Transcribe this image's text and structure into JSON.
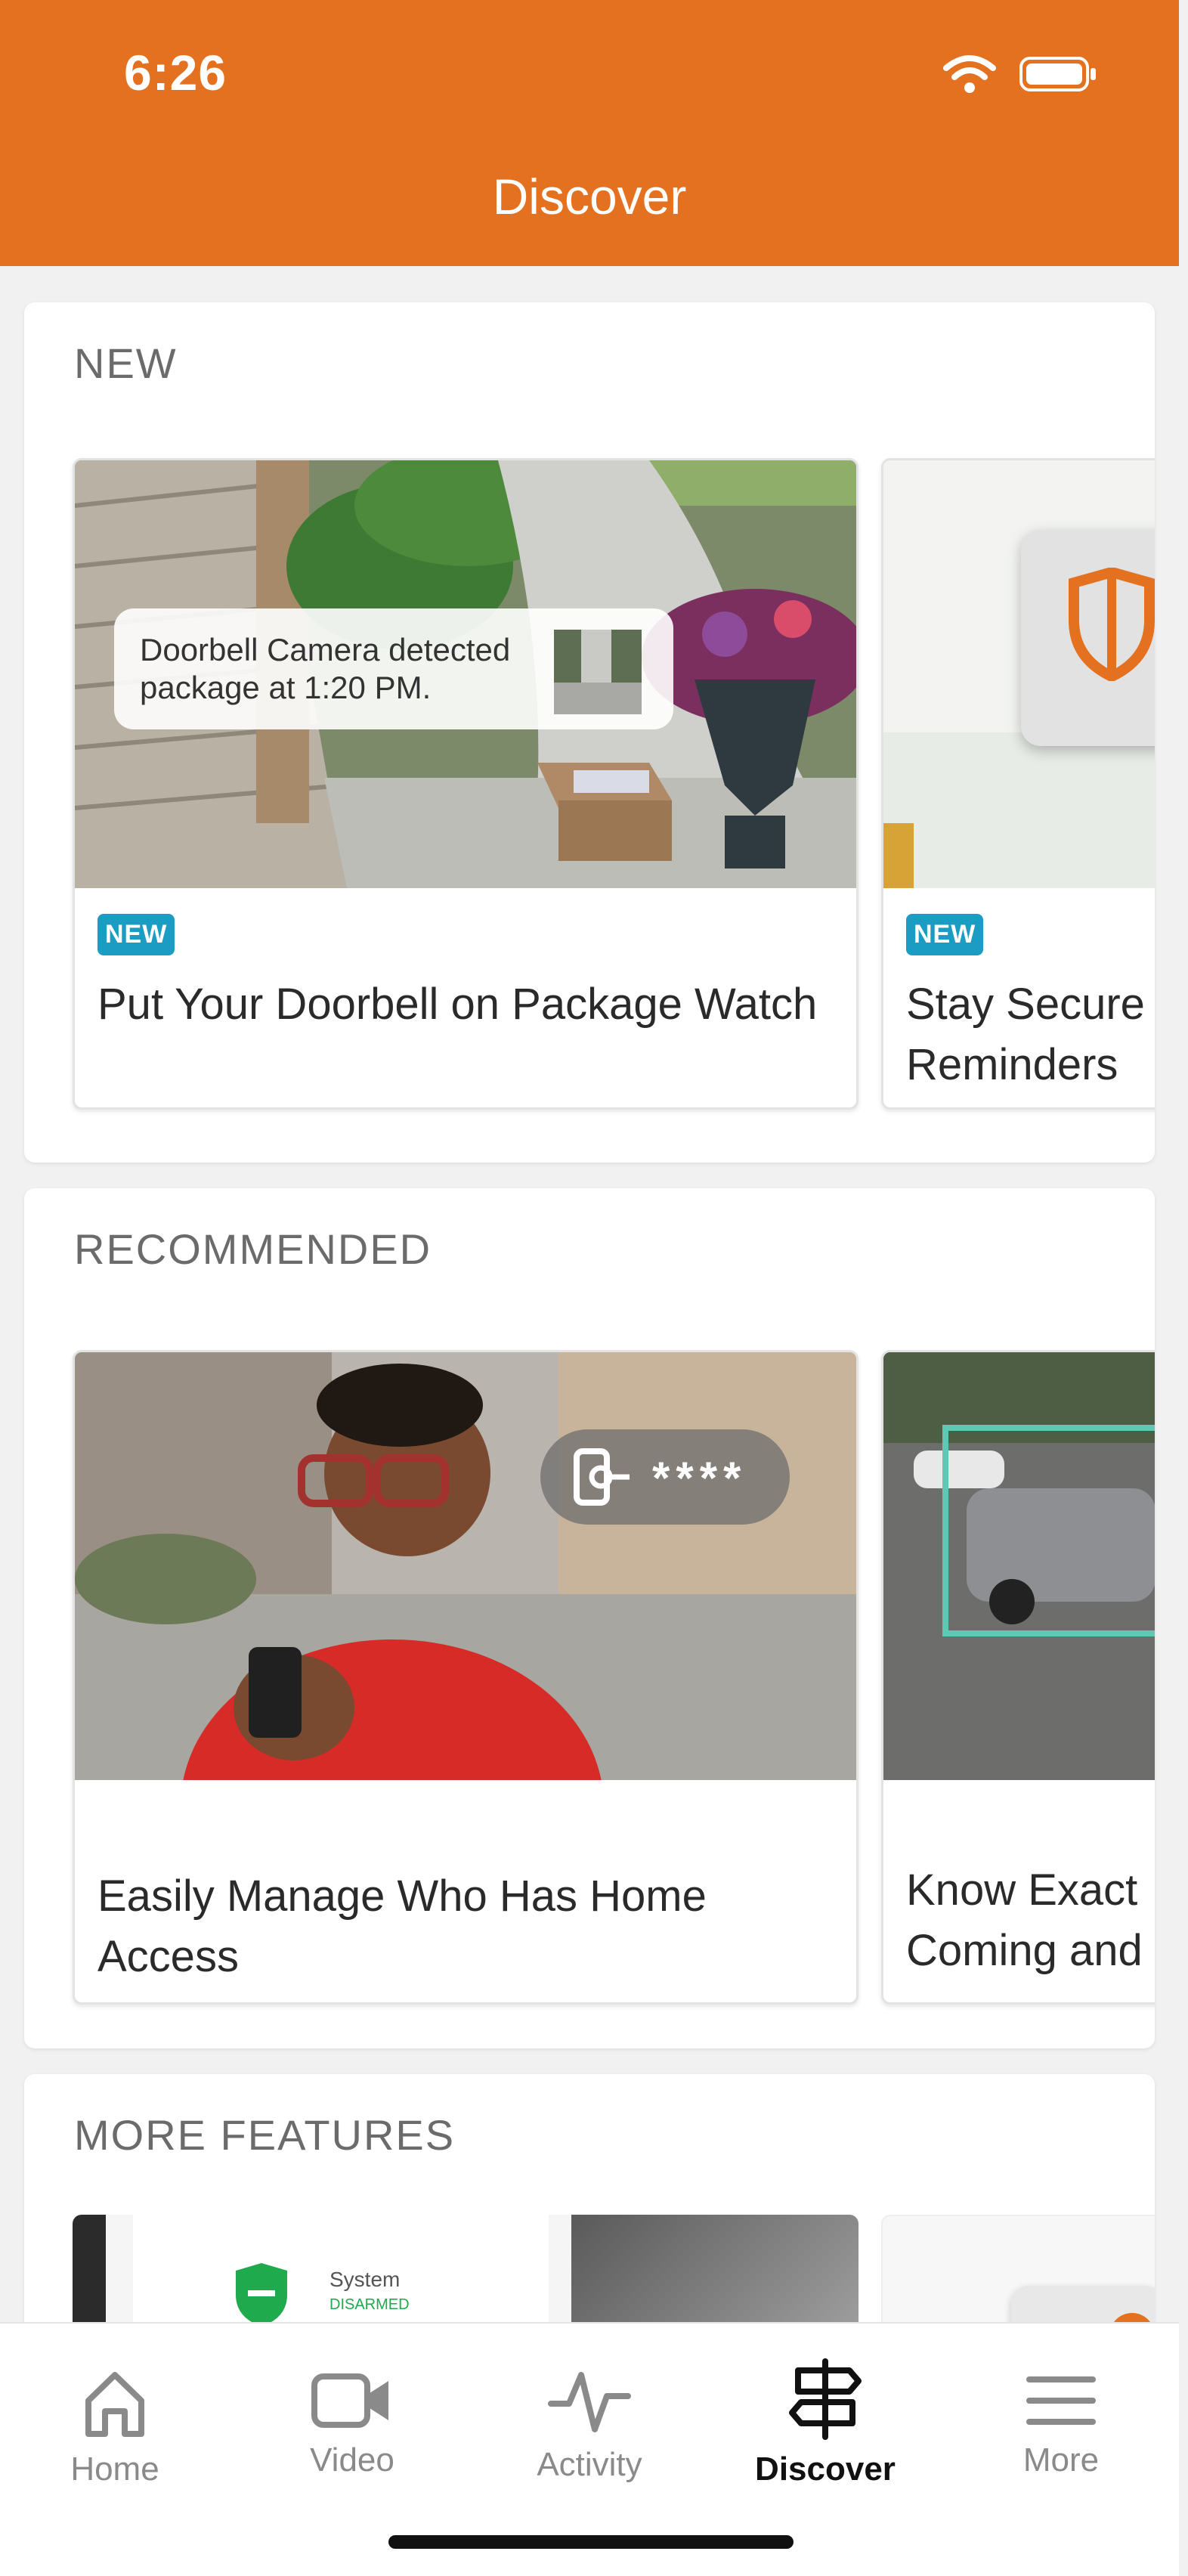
{
  "status": {
    "time": "6:26"
  },
  "header": {
    "title": "Discover"
  },
  "sections": {
    "new": {
      "title": "NEW",
      "cards": [
        {
          "badge": "NEW",
          "title": "Put Your Doorbell on Package Watch",
          "notification": "Doorbell Camera detected package at 1:20 PM."
        },
        {
          "badge": "NEW",
          "title": "Stay Secure Reminders"
        }
      ]
    },
    "recommended": {
      "title": "RECOMMENDED",
      "cards": [
        {
          "title": "Easily Manage Who Has Home Access",
          "pin_overlay": "****"
        },
        {
          "title": "Know Exact Coming and"
        }
      ]
    },
    "more": {
      "title": "MORE FEATURES",
      "preview_text": [
        "System",
        "DISARMED"
      ]
    }
  },
  "tabs": [
    {
      "label": "Home",
      "icon": "home-icon"
    },
    {
      "label": "Video",
      "icon": "video-icon"
    },
    {
      "label": "Activity",
      "icon": "activity-icon"
    },
    {
      "label": "Discover",
      "icon": "discover-icon",
      "active": true
    },
    {
      "label": "More",
      "icon": "menu-icon"
    }
  ],
  "colors": {
    "accent": "#e4711f",
    "badge": "#1b9cc2"
  }
}
